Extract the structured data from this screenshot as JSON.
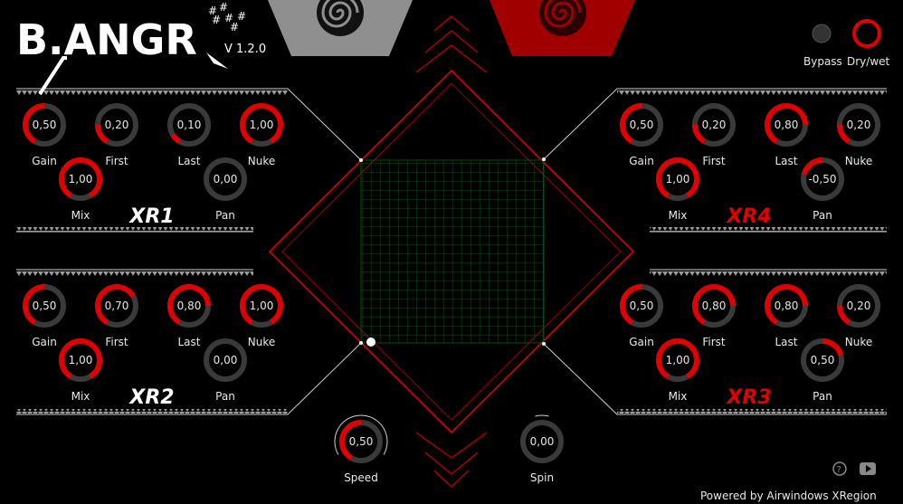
{
  "app": {
    "logo_text": "B.ANGR",
    "version": "V 1.2.0",
    "footer": "Powered by Airwindows XRegion"
  },
  "header": {
    "bypass_label": "Bypass",
    "drywet_label": "Dry/wet",
    "drywet_value": 1.0
  },
  "colors": {
    "accent": "#e00000",
    "knob_track": "#3a3a3a",
    "grid": "#0f4a12",
    "white_line": "#cfcfcf"
  },
  "modules": [
    {
      "id": "xr1",
      "title": "XR1",
      "title_color": "#ffffff",
      "knobs": [
        {
          "label": "Gain",
          "value": "0,50",
          "fill": 0.5
        },
        {
          "label": "First",
          "value": "0,20",
          "fill": 0.2
        },
        {
          "label": "Last",
          "value": "0,10",
          "fill": 0.1
        },
        {
          "label": "Nuke",
          "value": "1,00",
          "fill": 1.0
        },
        {
          "label": "Mix",
          "value": "1,00",
          "fill": 1.0
        },
        {
          "label": "Pan",
          "value": "0,00",
          "fill": 0.5,
          "bipolar": true
        }
      ]
    },
    {
      "id": "xr2",
      "title": "XR2",
      "title_color": "#ffffff",
      "knobs": [
        {
          "label": "Gain",
          "value": "0,50",
          "fill": 0.5
        },
        {
          "label": "First",
          "value": "0,70",
          "fill": 0.7
        },
        {
          "label": "Last",
          "value": "0,80",
          "fill": 0.8
        },
        {
          "label": "Nuke",
          "value": "1,00",
          "fill": 1.0
        },
        {
          "label": "Mix",
          "value": "1,00",
          "fill": 1.0
        },
        {
          "label": "Pan",
          "value": "0,00",
          "fill": 0.5,
          "bipolar": true
        }
      ]
    },
    {
      "id": "xr4",
      "title": "XR4",
      "title_color": "#e00000",
      "knobs": [
        {
          "label": "Gain",
          "value": "0,50",
          "fill": 0.5
        },
        {
          "label": "First",
          "value": "0,20",
          "fill": 0.2
        },
        {
          "label": "Last",
          "value": "0,80",
          "fill": 0.8
        },
        {
          "label": "Nuke",
          "value": "0,20",
          "fill": 0.2
        },
        {
          "label": "Mix",
          "value": "1,00",
          "fill": 1.0
        },
        {
          "label": "Pan",
          "value": "-0,50",
          "fill": 0.25,
          "bipolar": true
        }
      ]
    },
    {
      "id": "xr3",
      "title": "XR3",
      "title_color": "#e00000",
      "knobs": [
        {
          "label": "Gain",
          "value": "0,50",
          "fill": 0.5
        },
        {
          "label": "First",
          "value": "0,80",
          "fill": 0.8
        },
        {
          "label": "Last",
          "value": "0,80",
          "fill": 0.8
        },
        {
          "label": "Nuke",
          "value": "0,20",
          "fill": 0.2
        },
        {
          "label": "Mix",
          "value": "1,00",
          "fill": 1.0
        },
        {
          "label": "Pan",
          "value": "0,50",
          "fill": 0.75,
          "bipolar": true
        }
      ]
    }
  ],
  "bottom": {
    "speed": {
      "label": "Speed",
      "value": "0,50",
      "fill": 0.5
    },
    "spin": {
      "label": "Spin",
      "value": "0,00",
      "fill": 0.5,
      "bipolar": true
    }
  },
  "icons": {
    "help": "question-icon",
    "video": "youtube-icon"
  }
}
